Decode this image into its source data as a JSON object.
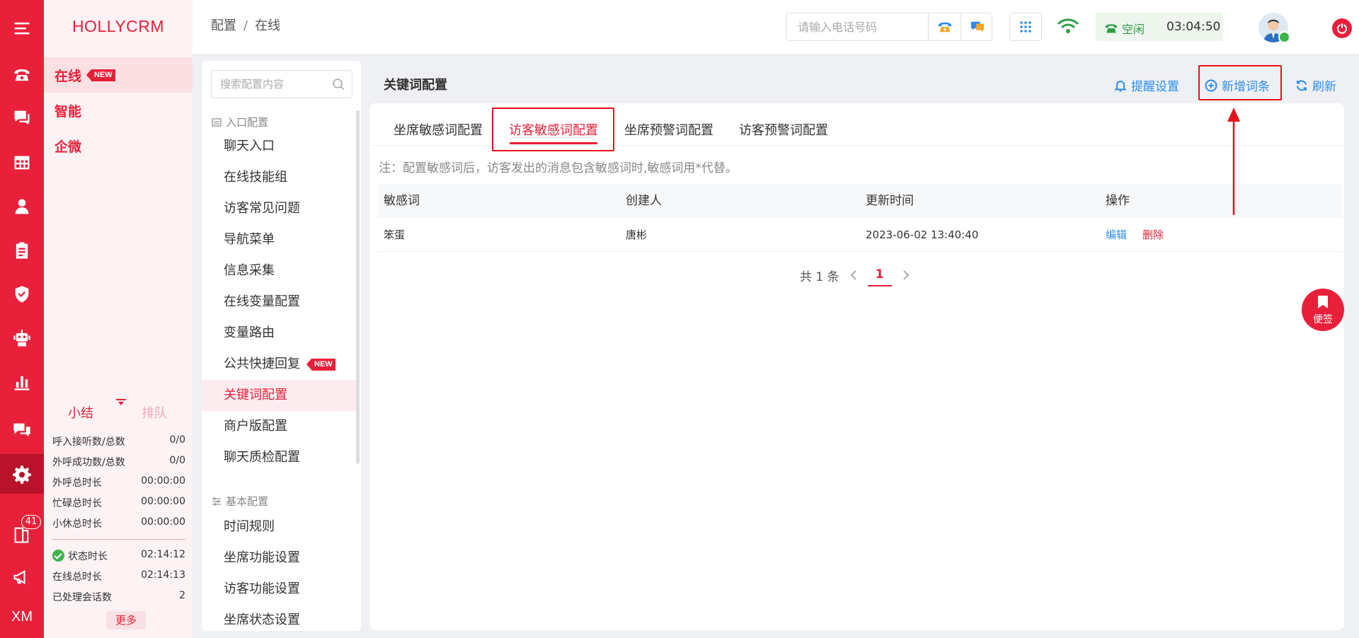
{
  "app": {
    "brand": "HOLLYCRM"
  },
  "rail": {
    "items": [
      "menu-icon",
      "phone-icon",
      "chat-icon",
      "grid-table-icon",
      "user-icon",
      "clipboard-icon",
      "shield-icon",
      "robot-icon",
      "bar-chart-icon",
      "comments-icon",
      "settings-icon",
      "book-icon",
      "megaphone-icon",
      "xm-logo"
    ],
    "badge": "41",
    "xm_text": "XM"
  },
  "nav": {
    "items": [
      {
        "label": "在线",
        "tag": "NEW"
      },
      {
        "label": "智能"
      },
      {
        "label": "企微"
      }
    ],
    "stats": {
      "tab_summary": "小结",
      "tab_queue": "排队",
      "rows": [
        {
          "label": "呼入接听数/总数",
          "value": "0/0"
        },
        {
          "label": "外呼成功数/总数",
          "value": "0/0"
        },
        {
          "label": "外呼总时长",
          "value": "00:00:00"
        },
        {
          "label": "忙碌总时长",
          "value": "00:00:00"
        },
        {
          "label": "小休总时长",
          "value": "00:00:00"
        }
      ],
      "rows2": [
        {
          "label": "状态时长",
          "value": "02:14:12"
        },
        {
          "label": "在线总时长",
          "value": "02:14:13"
        },
        {
          "label": "已处理会话数",
          "value": "2"
        }
      ],
      "more": "更多"
    }
  },
  "topbar": {
    "breadcrumb": [
      "配置",
      "在线"
    ],
    "breadcrumb_sep": "/",
    "phone_placeholder": "请输入电话号码",
    "status_label": "空闲",
    "status_time": "03:04:50"
  },
  "menu": {
    "search_placeholder": "搜索配置内容",
    "group1": "入口配置",
    "group1_items": [
      "聊天入口",
      "在线技能组",
      "访客常见问题",
      "导航菜单",
      "信息采集",
      "在线变量配置",
      "变量路由",
      "公共快捷回复",
      "关键词配置",
      "商户版配置",
      "聊天质检配置"
    ],
    "new_tag": "NEW",
    "group2": "基本配置",
    "group2_items": [
      "时间规则",
      "坐席功能设置",
      "访客功能设置",
      "坐席状态设置"
    ]
  },
  "content": {
    "title": "关键词配置",
    "actions": {
      "remind": "提醒设置",
      "add": "新增词条",
      "refresh": "刷新"
    },
    "tabs": [
      "坐席敏感词配置",
      "访客敏感词配置",
      "坐席预警词配置",
      "访客预警词配置"
    ],
    "active_tab": 1,
    "note": "注：配置敏感词后，访客发出的消息包含敏感词时,敏感词用*代替。",
    "table": {
      "headers": [
        "敏感词",
        "创建人",
        "更新时间",
        "操作"
      ],
      "rows": [
        {
          "word": "笨蛋",
          "creator": "唐彬",
          "updated": "2023-06-02 13:40:40",
          "edit": "编辑",
          "delete": "删除"
        }
      ]
    },
    "pager": {
      "total": "共 1 条",
      "current": "1"
    }
  },
  "sticky_note": "便签",
  "colors": {
    "brand": "#e8203a",
    "link": "#2d8cf0",
    "ok": "#3cb44b",
    "highlight": "#e8101c"
  }
}
